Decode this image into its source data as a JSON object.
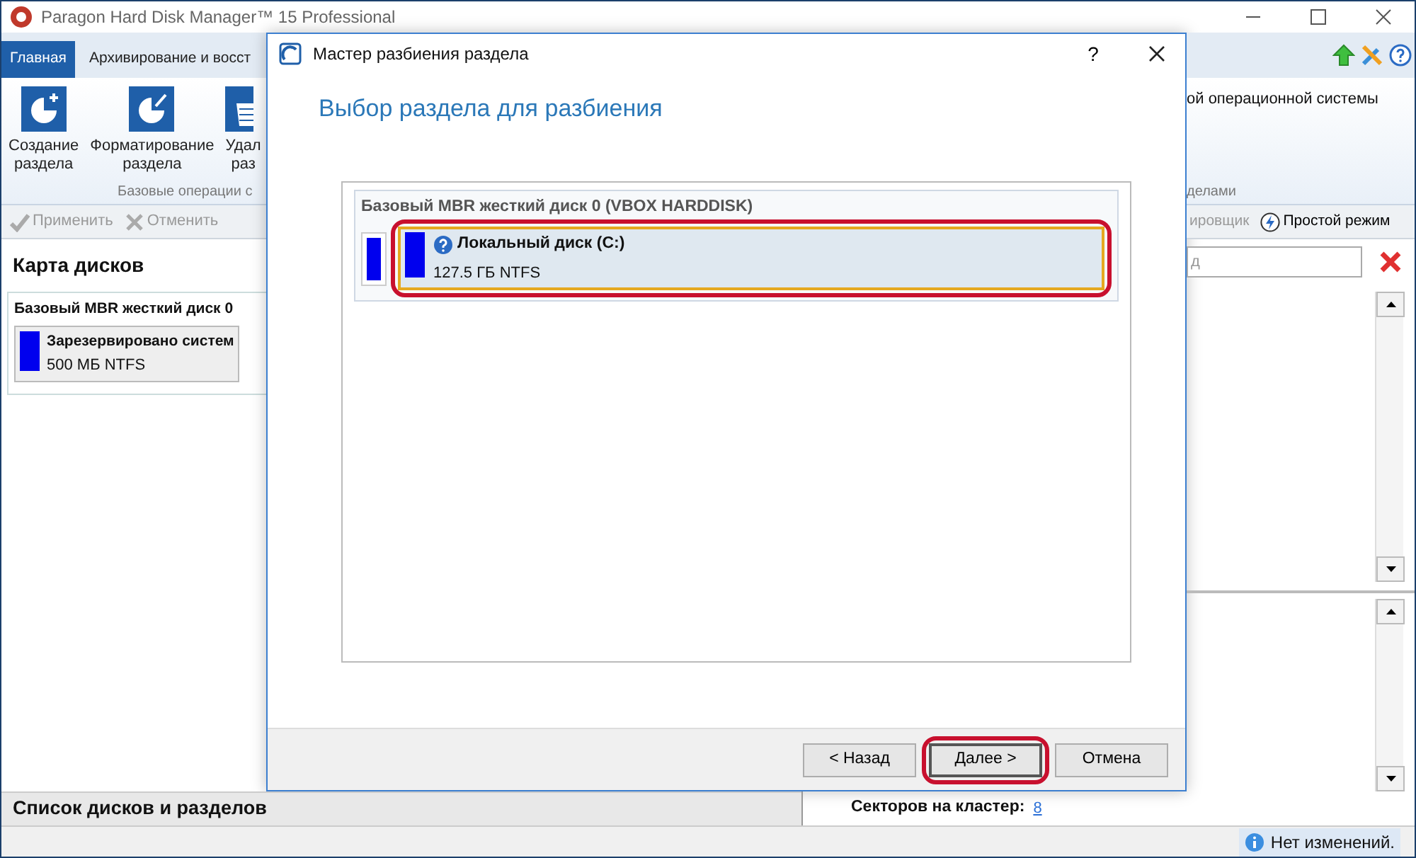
{
  "main_window": {
    "title": "Paragon Hard Disk Manager™ 15 Professional",
    "tabs": [
      {
        "label": "Главная",
        "selected": true
      },
      {
        "label": "Архивирование и восст",
        "selected": false
      }
    ],
    "ribbon_buttons": [
      {
        "lines": [
          "Создание",
          "раздела"
        ]
      },
      {
        "lines": [
          "Форматирование",
          "раздела"
        ]
      },
      {
        "lines": [
          "Удал",
          "раз"
        ]
      }
    ],
    "ribbon_group_label": "Базовые операции с",
    "ribbon_right_text": "ой операционной системы",
    "ribbon_right_group_label": "делами",
    "toolbar_left": [
      {
        "label": "Применить",
        "disabled": true
      },
      {
        "label": "Отменить",
        "disabled": true
      }
    ],
    "toolbar_right": [
      {
        "label": "ировщик",
        "disabled": true
      },
      {
        "label": "Простой режим",
        "disabled": false
      }
    ],
    "disk_map": {
      "title": "Карта дисков",
      "disk_label": "Базовый MBR жесткий диск 0",
      "partition_name": "Зарезервировано систем",
      "partition_size": "500 МБ NTFS"
    },
    "search": {
      "placeholder": "д"
    },
    "bottom_panel": {
      "title": "Список дисков и разделов"
    },
    "details": {
      "label": "Секторов на кластер:",
      "value": "8"
    },
    "status_bar": "Нет изменений."
  },
  "dialog": {
    "title": "Мастер разбиения раздела",
    "help": "?",
    "heading": "Выбор раздела для разбиения",
    "disk_label": "Базовый MBR жесткий диск 0 (VBOX HARDDISK)",
    "partitions": [
      {
        "kind": "small",
        "selected": false,
        "highlighted": false
      },
      {
        "kind": "volume",
        "name": "Локальный диск (C:)",
        "size": "127.5 ГБ NTFS",
        "selected": true,
        "highlighted": true
      }
    ],
    "buttons": [
      {
        "label": "< Назад",
        "highlighted": false
      },
      {
        "label": "Далее >",
        "highlighted": true
      },
      {
        "label": "Отмена",
        "highlighted": false
      }
    ]
  }
}
